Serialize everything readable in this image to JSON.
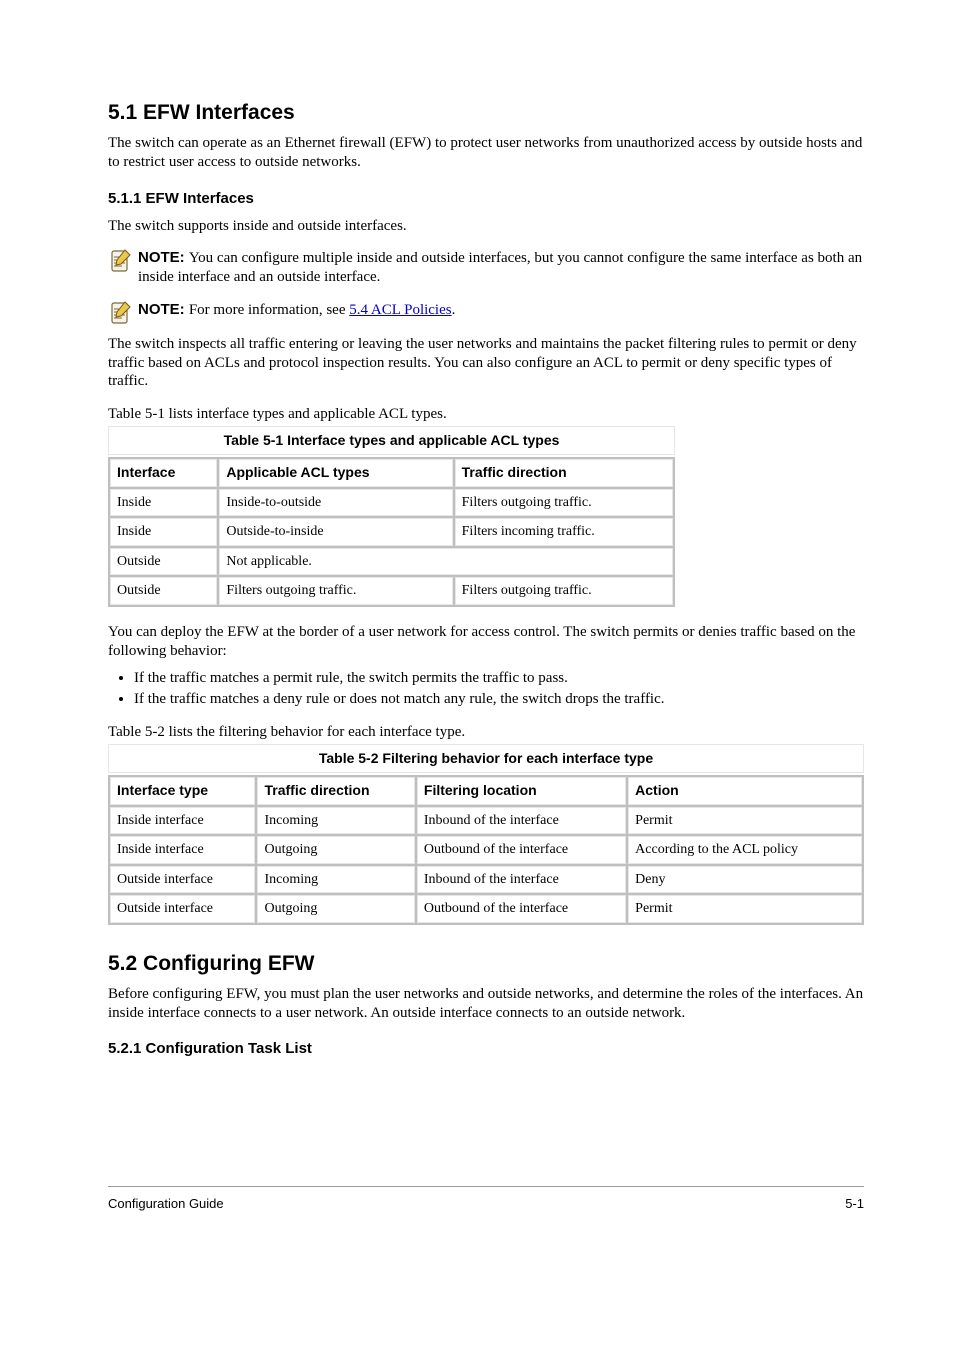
{
  "sections": {
    "heading1": "5.1 EFW Interfaces",
    "intro1": "The switch can operate as an Ethernet firewall (EFW) to protect user networks from unauthorized access by outside hosts and to restrict user access to outside networks.",
    "subheading1": "5.1.1 EFW Interfaces",
    "intro2": "The switch supports inside and outside interfaces.",
    "note1_label": "NOTE: ",
    "note1_text": "You can configure multiple inside and outside interfaces, but you cannot configure the same interface as both an inside interface and an outside interface.",
    "note2_label": "NOTE: ",
    "note2_pre": "For more information, see ",
    "note2_link": "5.4 ACL Policies",
    "note2_post": ".",
    "intro3": "The switch inspects all traffic entering or leaving the user networks and maintains the packet filtering rules to permit or deny traffic based on ACLs and protocol inspection results. You can also configure an ACL to permit or deny specific types of traffic.",
    "table1_caption_before": "Table 5-1 lists interface types and applicable ACL types.",
    "table1": {
      "title": "Table 5-1 Interface types and applicable ACL types",
      "headers": [
        "Interface",
        "Applicable ACL types",
        "Traffic direction"
      ],
      "rows": [
        [
          "Inside",
          "Inside-to-outside",
          "Filters outgoing traffic."
        ],
        [
          "Inside",
          "Outside-to-inside",
          "Filters incoming traffic."
        ],
        {
          "span": true,
          "cells": [
            "Outside",
            "Not applicable."
          ]
        },
        [
          "Outside",
          "Filters outgoing traffic.",
          "Filters outgoing traffic."
        ]
      ]
    },
    "intro4": "You can deploy the EFW at the border of a user network for access control. The switch permits or denies traffic based on the following behavior:",
    "bullets": [
      "If the traffic matches a permit rule, the switch permits the traffic to pass.",
      "If the traffic matches a deny rule or does not match any rule, the switch drops the traffic."
    ],
    "table2_caption_before": "Table 5-2 lists the filtering behavior for each interface type.",
    "table2": {
      "title": "Table 5-2 Filtering behavior for each interface type",
      "headers": [
        "Interface type",
        "Traffic direction",
        "Filtering location",
        "Action"
      ],
      "rows": [
        [
          "Inside interface",
          "Incoming",
          "Inbound of the interface",
          "Permit"
        ],
        [
          "Inside interface",
          "Outgoing",
          "Outbound of the interface",
          "According to the ACL policy"
        ],
        [
          "Outside interface",
          "Incoming",
          "Inbound of the interface",
          "Deny"
        ],
        [
          "Outside interface",
          "Outgoing",
          "Outbound of the interface",
          "Permit"
        ]
      ]
    },
    "heading2": "5.2 Configuring EFW",
    "intro5": "Before configuring EFW, you must plan the user networks and outside networks, and determine the roles of the interfaces. An inside interface connects to a user network. An outside interface connects to an outside network.",
    "subheading2": "5.2.1 Configuration Task List"
  },
  "footer": {
    "left": "Configuration Guide",
    "right": "5-1"
  }
}
